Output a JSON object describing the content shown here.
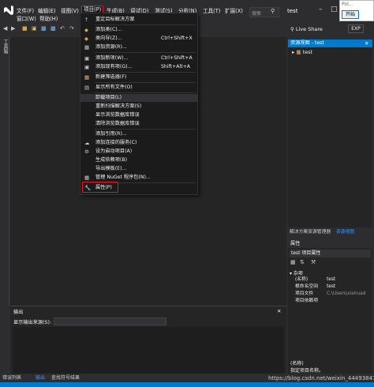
{
  "menubar": {
    "file": "文件(F)",
    "edit": "编辑(E)",
    "view": "视图(V)",
    "project": "项目(P)",
    "build": "生成(B)",
    "debug": "调试(D)",
    "test": "测试(S)",
    "analyze": "分析(N)",
    "tools": "工具(T)",
    "extensions": "扩展(X)",
    "window": "窗口(W)",
    "help": "帮助(H)"
  },
  "search_placeholder": "搜索",
  "solution_name": "test",
  "popup": {
    "title": "Pol...",
    "start_button": "开始"
  },
  "left_strip_label": "工具箱",
  "dropdown": {
    "retarget": "重定目标解决方案",
    "add_class": "添加类(C)...",
    "add_class_sc": "",
    "class_wizard": "类向导(Z)...",
    "class_wizard_sc": "Ctrl+Shift+X",
    "add_resource": "添加资源(R)...",
    "add_new_item": "添加新项(W)...",
    "add_new_item_sc": "Ctrl+Shift+A",
    "add_existing_item": "添加现有项(G)...",
    "add_existing_item_sc": "Shift+Alt+A",
    "new_filter": "新建筛选器(F)",
    "show_all_files": "显示所有文件(O)",
    "unload_project": "卸载项目(L)",
    "rescan_solution": "重新扫描解决方案(S)",
    "show_db_errors": "显示浏览数据库错误",
    "clear_db_errors": "清除浏览数据库错误",
    "add_reference": "添加引用(R)...",
    "add_connected_service": "添加连接的服务(C)",
    "set_startup": "设为启动项目(A)",
    "build_dependencies": "生成依赖项(B)",
    "export_template": "导出模板(E)...",
    "manage_nuget": "管理 NuGet 程序包(N)...",
    "properties": "属性(P)"
  },
  "right_panel": {
    "live_share": "Live Share",
    "exp_button": "EXP",
    "solution_explorer_title": "资源视图 - test",
    "tree_item": "test",
    "tab_solution_explorer": "解决方案资源管理器",
    "tab_resource_view": "资源视图"
  },
  "properties": {
    "title": "属性",
    "selector": "test 项目属性",
    "group": "杂项",
    "rows": [
      {
        "key": "(名称)",
        "value": "test"
      },
      {
        "key": "根命名空间",
        "value": "test"
      },
      {
        "key": "项目文件",
        "value": "C:\\Users\\xiahuad"
      },
      {
        "key": "项目依赖项",
        "value": ""
      }
    ],
    "desc_title": "(名称)",
    "desc_text": "指定项目名称。"
  },
  "output": {
    "title": "输出",
    "source_label": "显示输出来源(S):"
  },
  "bottom_tabs": {
    "error_list": "错误列表",
    "output": "输出",
    "find_symbol": "查找符号结果"
  },
  "watermark": "https://blog.csdn.net/weixin_44493841",
  "colors": {
    "accent": "#007acc",
    "highlight_red": "#e81123"
  }
}
